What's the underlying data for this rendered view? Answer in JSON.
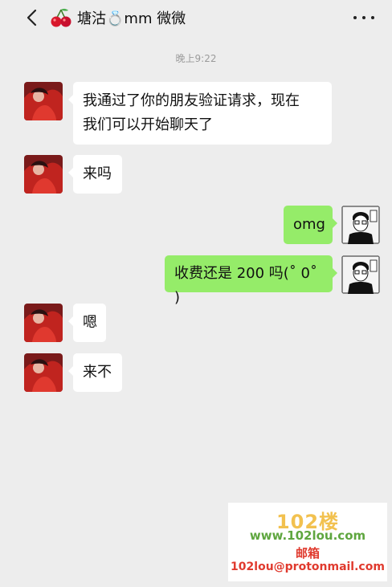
{
  "header": {
    "contact_name": "塘沽💍mm 微微",
    "back_icon": "chevron-left-icon",
    "more_icon": "more-horizontal-icon"
  },
  "chat": {
    "timestamp": "晚上9:22",
    "messages": [
      {
        "side": "left",
        "text_line1": "我通过了你的朋友验证请求，现在",
        "text_line2": "我们可以开始聊天了"
      },
      {
        "side": "left",
        "text": "来吗"
      },
      {
        "side": "right",
        "text": "omg"
      },
      {
        "side": "right",
        "text": "收费还是 200 吗(˚ 0˚ )"
      },
      {
        "side": "left",
        "text": "嗯"
      },
      {
        "side": "left",
        "text": "来不"
      }
    ]
  },
  "watermark": {
    "logo": "102楼",
    "site": "www.102lou.com",
    "mail_label": "邮箱",
    "email": "102lou@protonmail.com"
  },
  "colors": {
    "background": "#ededed",
    "incoming_bubble": "#ffffff",
    "outgoing_bubble": "#95ec69"
  }
}
